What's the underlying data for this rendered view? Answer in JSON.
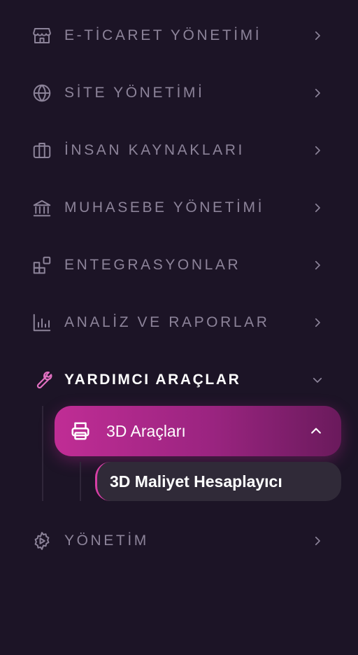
{
  "menu": {
    "ecommerce": "E-TİCARET YÖNETİMİ",
    "site": "SİTE YÖNETİMİ",
    "hr": "İNSAN KAYNAKLARI",
    "accounting": "MUHASEBE YÖNETİMİ",
    "integrations": "ENTEGRASYONLAR",
    "analytics": "ANALİZ VE RAPORLAR",
    "tools": "YARDIMCI ARAÇLAR",
    "admin": "YÖNETİM"
  },
  "submenu": {
    "tools_3d": "3D Araçları",
    "cost_calculator": "3D Maliyet Hesaplayıcı"
  },
  "colors": {
    "background": "#1c1426",
    "muted_text": "#8c8399",
    "accent": "#c02d95",
    "accent_icon": "#e070c0"
  }
}
